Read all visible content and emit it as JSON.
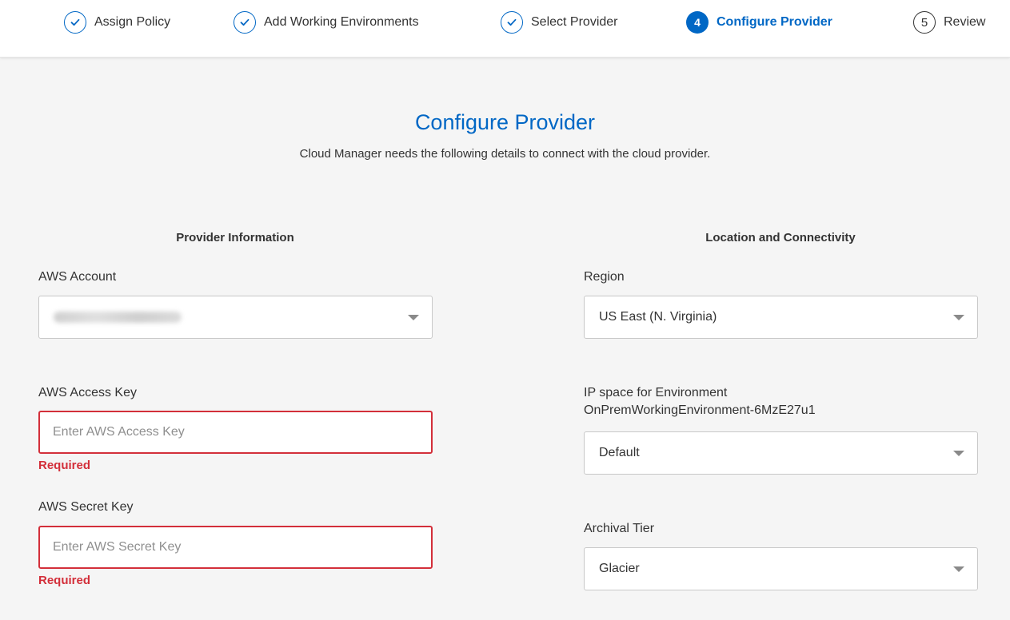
{
  "stepper": {
    "steps": [
      {
        "label": "Assign Policy",
        "status": "done"
      },
      {
        "label": "Add Working Environments",
        "status": "done"
      },
      {
        "label": "Select Provider",
        "status": "done"
      },
      {
        "label": "Configure Provider",
        "status": "active",
        "number": "4"
      },
      {
        "label": "Review",
        "status": "pending",
        "number": "5"
      }
    ]
  },
  "page": {
    "title": "Configure Provider",
    "subtitle": "Cloud Manager needs the following details to connect with the cloud provider."
  },
  "provider_info": {
    "heading": "Provider Information",
    "aws_account": {
      "label": "AWS Account"
    },
    "access_key": {
      "label": "AWS Access Key",
      "placeholder": "Enter AWS Access Key",
      "value": "",
      "error": "Required"
    },
    "secret_key": {
      "label": "AWS Secret Key",
      "placeholder": "Enter AWS Secret Key",
      "value": "",
      "error": "Required"
    }
  },
  "location": {
    "heading": "Location and Connectivity",
    "region": {
      "label": "Region",
      "value": "US East (N. Virginia)"
    },
    "ip_space": {
      "label_line1": "IP space for Environment",
      "label_line2": "OnPremWorkingEnvironment-6MzE27u1",
      "value": "Default"
    },
    "archival_tier": {
      "label": "Archival Tier",
      "value": "Glacier"
    }
  },
  "colors": {
    "accent": "#0067c5",
    "error": "#d32f3a",
    "background": "#f5f5f5"
  },
  "icons": {
    "done_step": "check-circle-icon",
    "dropdown": "caret-down-icon"
  }
}
